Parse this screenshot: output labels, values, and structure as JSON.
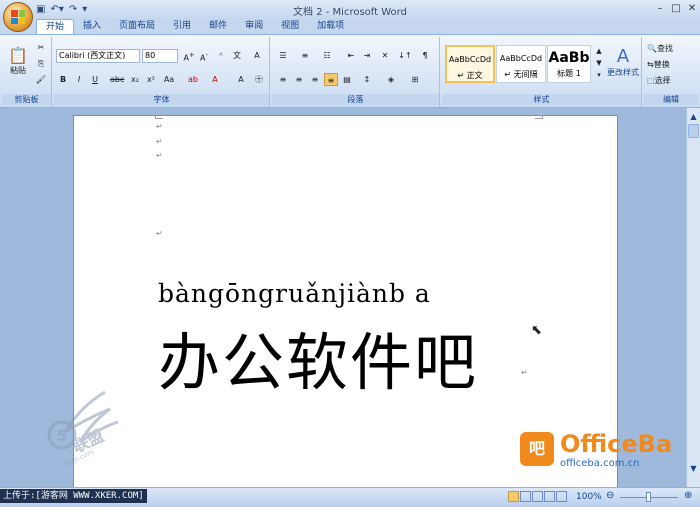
{
  "window": {
    "title": "文档 2 - Microsoft Word"
  },
  "tabs": [
    "开始",
    "插入",
    "页面布局",
    "引用",
    "邮件",
    "审阅",
    "视图",
    "加载项"
  ],
  "clipboard": {
    "paste_label": "粘贴",
    "group_label": "剪贴板"
  },
  "font": {
    "font_name": "Calibri (西文正文)",
    "font_size": "80",
    "group_label": "字体"
  },
  "paragraph": {
    "group_label": "段落"
  },
  "styles": {
    "items": [
      {
        "preview": "AaBbCcDd",
        "name": "↵ 正文"
      },
      {
        "preview": "AaBbCcDd",
        "name": "↵ 无间隔"
      },
      {
        "preview": "AaBb",
        "name": "标题 1"
      }
    ],
    "change_label": "更改样式",
    "group_label": "样式"
  },
  "editing": {
    "find": "查找",
    "replace": "替换",
    "select": "选择",
    "group_label": "编辑"
  },
  "document": {
    "pinyin": "bàngōngruǎnjiànb a",
    "hanzi": "办公软件吧",
    "para_mark": "↵"
  },
  "status": {
    "zoom": "100%",
    "upload_text": "上传于:[游客网 WWW.XKER.COM]"
  },
  "branding": {
    "officeba_logo": "OfficeBa",
    "officeba_url": "officeba.com.cn",
    "xker_logo": "5 联盟 Xker.com"
  }
}
